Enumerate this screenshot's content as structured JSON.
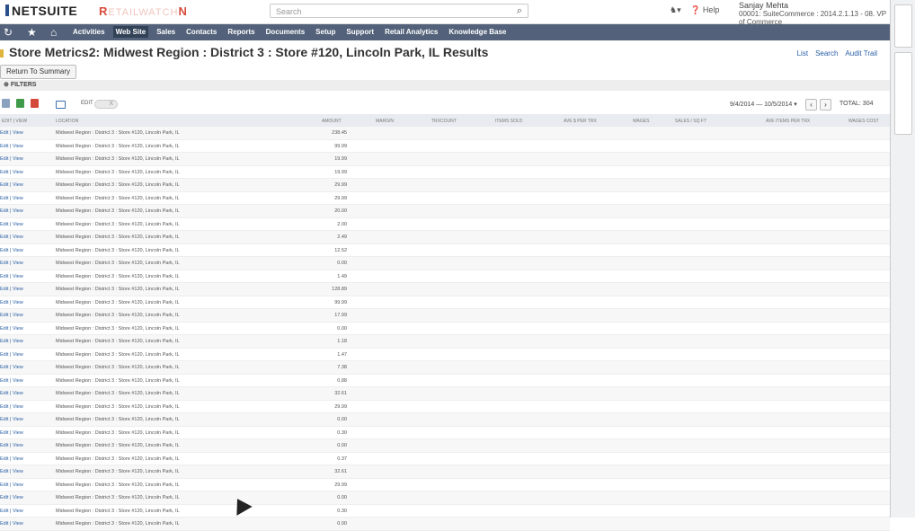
{
  "topbar": {
    "logo": "NETSUITE",
    "brand2_prefix": "R",
    "brand2_mid": "ETAILWATCH",
    "brand2_suffix": "N",
    "search_placeholder": "Search",
    "help_label": "Help",
    "user_name": "Sanjay Mehta",
    "user_role": "00001: SuiteCommerce : 2014.2.1.13 - 08. VP of Commerce"
  },
  "nav": {
    "items": [
      "Activities",
      "Web Site",
      "Sales",
      "Contacts",
      "Reports",
      "Documents",
      "Setup",
      "Support",
      "Retail Analytics",
      "Knowledge Base"
    ],
    "active": "Web Site"
  },
  "page": {
    "title": "Store Metrics2: Midwest Region : District 3 : Store #120, Lincoln Park, IL Results",
    "links": [
      "List",
      "Search",
      "Audit Trail"
    ],
    "return_button": "Return To Summary",
    "filters_label": "FILTERS"
  },
  "toolbar": {
    "edit_label": "EDIT",
    "toggle_label": "X",
    "date_range": "9/4/2014 — 10/5/2014",
    "total": "TOTAL: 304"
  },
  "columns": [
    "EDIT | VIEW",
    "LOCATION",
    "AMOUNT",
    "MARGIN",
    "TRXCOUNT",
    "ITEMS SOLD",
    "AVE $ PER TRX",
    "WAGES",
    "SALES / SQ FT",
    "AVE ITEMS PER TRX",
    "WAGES COST"
  ],
  "row_edit_view": "Edit | View",
  "row_location": "Midwest Region : District 3 : Store #120, Lincoln Park, IL",
  "amounts": [
    "238.45",
    "99.99",
    "19.99",
    "19.99",
    "29.99",
    "29.99",
    "20.00",
    "2.00",
    "2.49",
    "12.52",
    "0.00",
    "1.49",
    "128.89",
    "99.99",
    "17.99",
    "0.00",
    "1.18",
    "1.47",
    "7.38",
    "0.88",
    "32.61",
    "29.99",
    "0.00",
    "0.30",
    "0.00",
    "0.37",
    "32.61",
    "29.99",
    "0.00",
    "0.30",
    "0.00"
  ]
}
